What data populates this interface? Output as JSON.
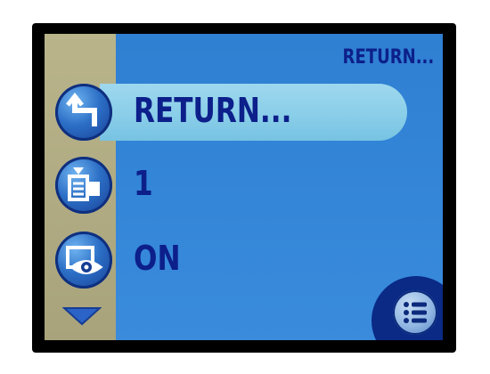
{
  "screen": {
    "header_title": "RETURN...",
    "menu_items": [
      {
        "label": "RETURN...",
        "icon": "return-arrow-icon",
        "selected": true
      },
      {
        "label": "1",
        "icon": "print-quantity-icon",
        "selected": false
      },
      {
        "label": "ON",
        "icon": "eye-view-icon",
        "selected": false
      }
    ],
    "scroll_icon": "chevron-down-icon",
    "menu_icon": "list-menu-icon"
  },
  "colors": {
    "screen_blue": "#3486d8",
    "side_strip": "#b9b48a",
    "highlight": "#88cde8",
    "text_navy": "#0c1f8a",
    "icon_blue": "#2c6fc6"
  }
}
